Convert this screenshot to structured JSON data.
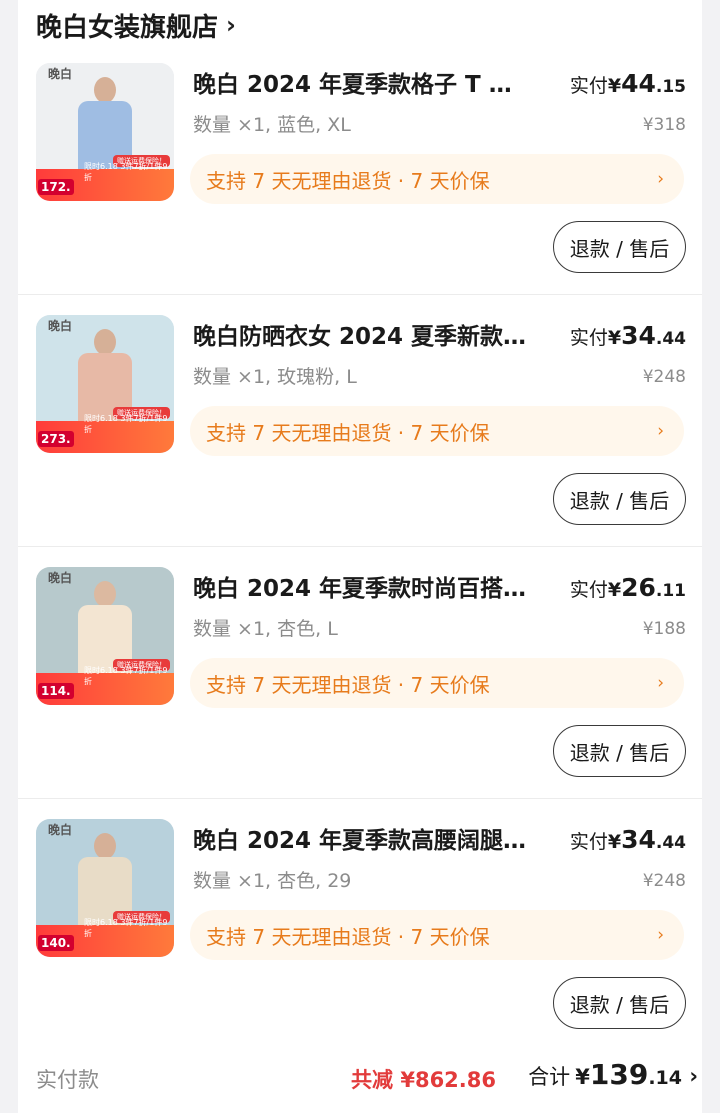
{
  "shop": {
    "name": "晚白女装旗舰店",
    "chevron": "›"
  },
  "items": [
    {
      "title": "晚白 2024 年夏季款格子 T 恤…",
      "spec": "数量 ×1, 蓝色, XL",
      "paid_label": "实付",
      "paid_yen": "¥",
      "paid_int": "44",
      "paid_dec": ".15",
      "orig_price": "¥318",
      "guarantee": "支持 7 天无理由退货 · 7 天价保",
      "guarantee_chevron": "›",
      "refund_label": "退款 / 售后",
      "thumb": {
        "logo": "晚白",
        "promo_price": "172.",
        "promo_line": "限时6.18  3件7折/1件9折",
        "promo_tag": "赠送运费保险！",
        "bg": "#eef0f2",
        "garment": "#9fbde3",
        "skin": "#d6b097"
      },
      "accent": "#9fbde3"
    },
    {
      "title": "晚白防晒衣女 2024 夏季新款…",
      "spec": "数量 ×1, 玫瑰粉, L",
      "paid_label": "实付",
      "paid_yen": "¥",
      "paid_int": "34",
      "paid_dec": ".44",
      "orig_price": "¥248",
      "guarantee": "支持 7 天无理由退货 · 7 天价保",
      "guarantee_chevron": "›",
      "refund_label": "退款 / 售后",
      "thumb": {
        "logo": "晚白",
        "promo_price": "273.",
        "promo_line": "限时6.18  3件7折/1件9折",
        "promo_tag": "赠送运费保险！",
        "bg": "#cfe3ea",
        "garment": "#e7b9a6",
        "skin": "#d6b097"
      },
      "accent": "#e7b9a6"
    },
    {
      "title": "晚白 2024 年夏季款时尚百搭…",
      "spec": "数量 ×1, 杏色, L",
      "paid_label": "实付",
      "paid_yen": "¥",
      "paid_int": "26",
      "paid_dec": ".11",
      "orig_price": "¥188",
      "guarantee": "支持 7 天无理由退货 · 7 天价保",
      "guarantee_chevron": "›",
      "refund_label": "退款 / 售后",
      "thumb": {
        "logo": "晚白",
        "promo_price": "114.",
        "promo_line": "限时6.18  3件7折/1件9折",
        "promo_tag": "赠送运费保险！",
        "bg": "#b7c9cc",
        "garment": "#f3e5d2",
        "skin": "#dcb9a0"
      },
      "accent": "#f3e5d2"
    },
    {
      "title": "晚白 2024 年夏季款高腰阔腿…",
      "spec": "数量 ×1, 杏色, 29",
      "paid_label": "实付",
      "paid_yen": "¥",
      "paid_int": "34",
      "paid_dec": ".44",
      "orig_price": "¥248",
      "guarantee": "支持 7 天无理由退货 · 7 天价保",
      "guarantee_chevron": "›",
      "refund_label": "退款 / 售后",
      "thumb": {
        "logo": "晚白",
        "promo_price": "140.",
        "promo_line": "限时6.18  3件7折/1件9折",
        "promo_tag": "赠送运费保险！",
        "bg": "#b8d1dc",
        "garment": "#e8dcc7",
        "skin": "#d6b097"
      },
      "accent": "#e8dcc7"
    }
  ],
  "footer": {
    "label": "实付款",
    "discount": "共减 ¥862.86",
    "total_label": "合计",
    "total_yen": "¥",
    "total_int": "139",
    "total_dec": ".14",
    "chevron": "›"
  }
}
